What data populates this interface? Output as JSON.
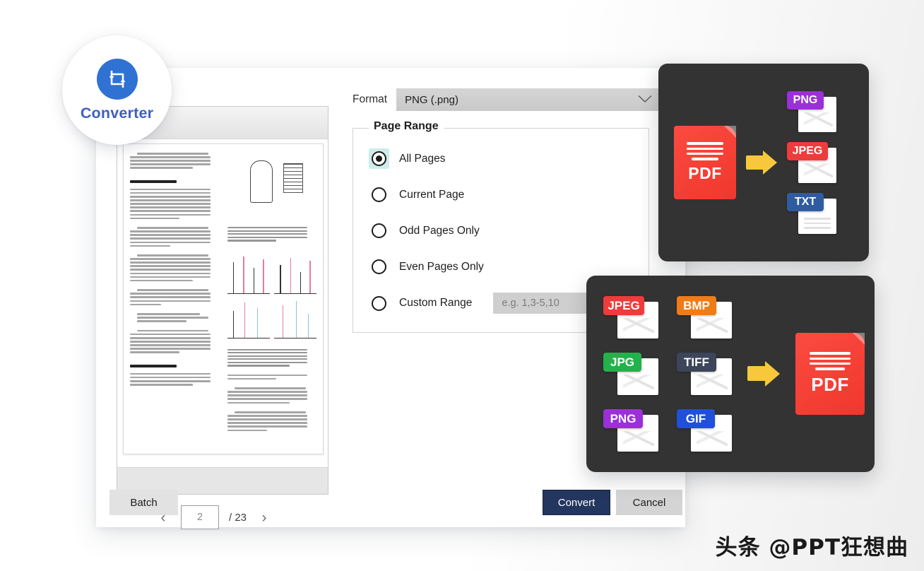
{
  "logo": {
    "text": "Converter",
    "icon": "convert-cycle-icon",
    "circle_color": "#2f72d4",
    "text_color": "#3f5fbf"
  },
  "dialog": {
    "format": {
      "label": "Format",
      "selected_value": "PNG (.png)",
      "chevron": "∨"
    },
    "page_range": {
      "legend": "Page Range",
      "options": [
        {
          "label": "All Pages",
          "selected": true
        },
        {
          "label": "Current Page",
          "selected": false
        },
        {
          "label": "Odd Pages Only",
          "selected": false
        },
        {
          "label": "Even Pages Only",
          "selected": false
        },
        {
          "label": "Custom Range",
          "selected": false
        }
      ],
      "custom_range_placeholder": "e.g. 1,3-5,10",
      "custom_range_value": "",
      "selected_highlight_color": "#cdeceb"
    },
    "pagination": {
      "prev_icon": "‹",
      "next_icon": "›",
      "current_page": "2",
      "total_label": "/ 23"
    },
    "buttons": {
      "batch": "Batch",
      "convert": "Convert",
      "cancel": "Cancel",
      "convert_color": "#23365f",
      "cancel_color": "#d4d4d4"
    }
  },
  "panels": {
    "top": {
      "source": {
        "label": "PDF",
        "color": "#f0372d"
      },
      "arrow": "arrow-right-icon",
      "targets": [
        {
          "label": "PNG",
          "color": "#9b30d9"
        },
        {
          "label": "JPEG",
          "color": "#ef3b3b"
        },
        {
          "label": "TXT",
          "color": "#2f5ca0"
        }
      ]
    },
    "bottom": {
      "sources": [
        {
          "label": "JPEG",
          "color": "#ef3b3b"
        },
        {
          "label": "BMP",
          "color": "#ef7c18"
        },
        {
          "label": "JPG",
          "color": "#22b24c"
        },
        {
          "label": "TIFF",
          "color": "#3c4559"
        },
        {
          "label": "PNG",
          "color": "#9b30d9"
        },
        {
          "label": "GIF",
          "color": "#1f4fdb"
        }
      ],
      "arrow": "arrow-right-icon",
      "target": {
        "label": "PDF",
        "color": "#f0372d"
      }
    },
    "background_color": "#333333"
  },
  "watermark": {
    "text": "头条 @PPT狂想曲"
  }
}
